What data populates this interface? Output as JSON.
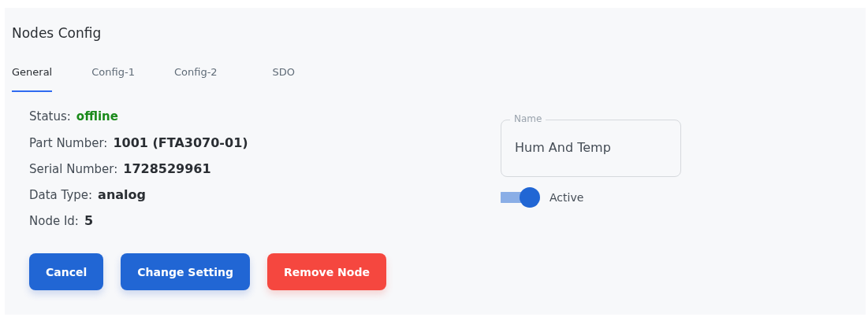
{
  "title": "Nodes Config",
  "tabs": [
    {
      "label": "General",
      "selected": true
    },
    {
      "label": "Config-1",
      "selected": false
    },
    {
      "label": "Config-2",
      "selected": false
    },
    {
      "label": "SDO",
      "selected": false
    }
  ],
  "details": [
    {
      "label": "Status:",
      "value": "offline",
      "kind": "status"
    },
    {
      "label": "Part Number:",
      "value": "1001 (FTA3070-01)",
      "kind": "plain"
    },
    {
      "label": "Serial Number:",
      "value": "1728529961",
      "kind": "plain"
    },
    {
      "label": "Data Type:",
      "value": "analog",
      "kind": "plain"
    },
    {
      "label": "Node Id:",
      "value": "5",
      "kind": "plain"
    }
  ],
  "name_field": {
    "label": "Name",
    "value": "Hum And Temp"
  },
  "active_toggle": {
    "label": "Active",
    "on": true
  },
  "buttons": [
    {
      "label": "Cancel",
      "kind": "primary"
    },
    {
      "label": "Change Setting",
      "kind": "primary"
    },
    {
      "label": "Remove Node",
      "kind": "danger"
    }
  ]
}
